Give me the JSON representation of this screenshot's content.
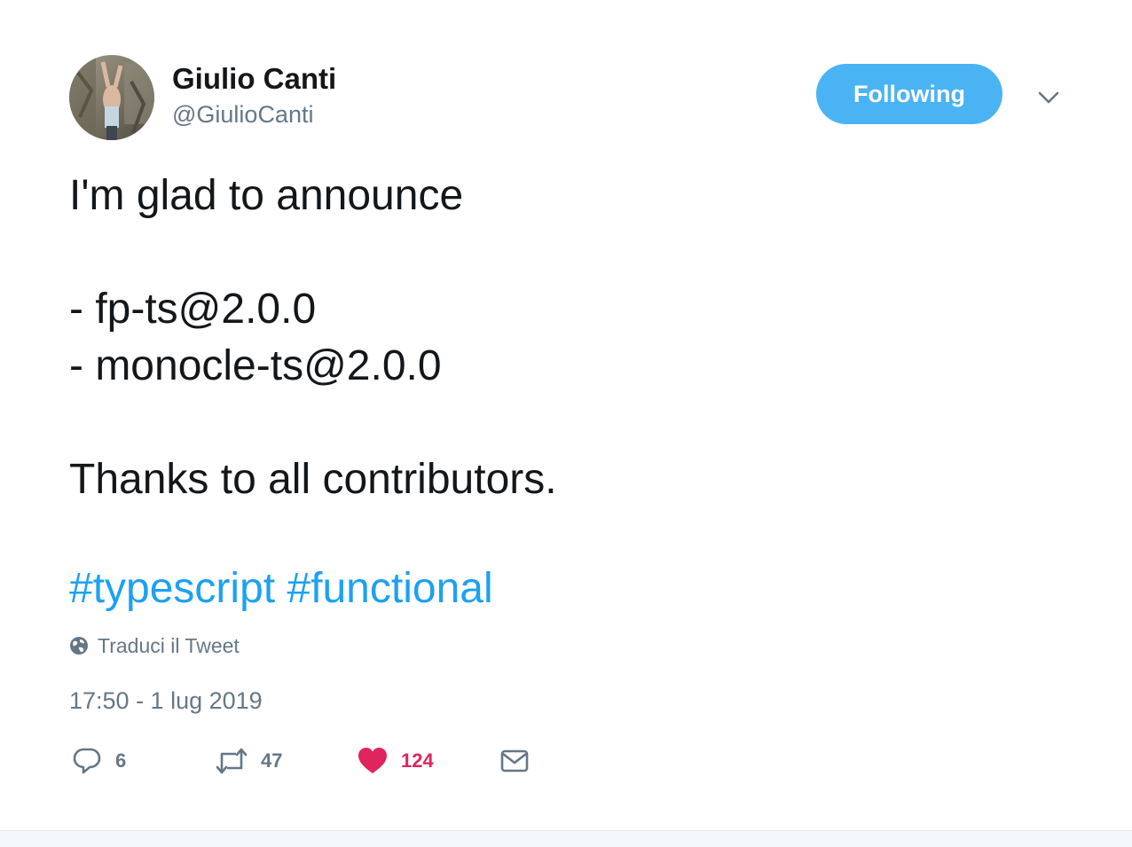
{
  "user": {
    "name": "Giulio Canti",
    "handle": "@GiulioCanti"
  },
  "follow_button": {
    "label": "Following"
  },
  "tweet": {
    "lines": [
      "I'm glad to announce",
      "- fp-ts@2.0.0",
      "- monocle-ts@2.0.0",
      "Thanks to all contributors."
    ],
    "hashtags": [
      "#typescript",
      "#functional"
    ]
  },
  "translate": {
    "label": "Traduci il Tweet",
    "icon": "globe-icon"
  },
  "timestamp": "17:50 - 1 lug 2019",
  "actions": {
    "reply": {
      "count": "6",
      "icon": "reply-icon"
    },
    "retweet": {
      "count": "47",
      "icon": "retweet-icon"
    },
    "like": {
      "count": "124",
      "icon": "heart-icon"
    },
    "message": {
      "icon": "mail-icon"
    }
  },
  "colors": {
    "accent": "#1da1f2",
    "follow_button": "#4ab3f4",
    "like": "#e0245e",
    "secondary_text": "#657786",
    "primary_text": "#14171a"
  }
}
